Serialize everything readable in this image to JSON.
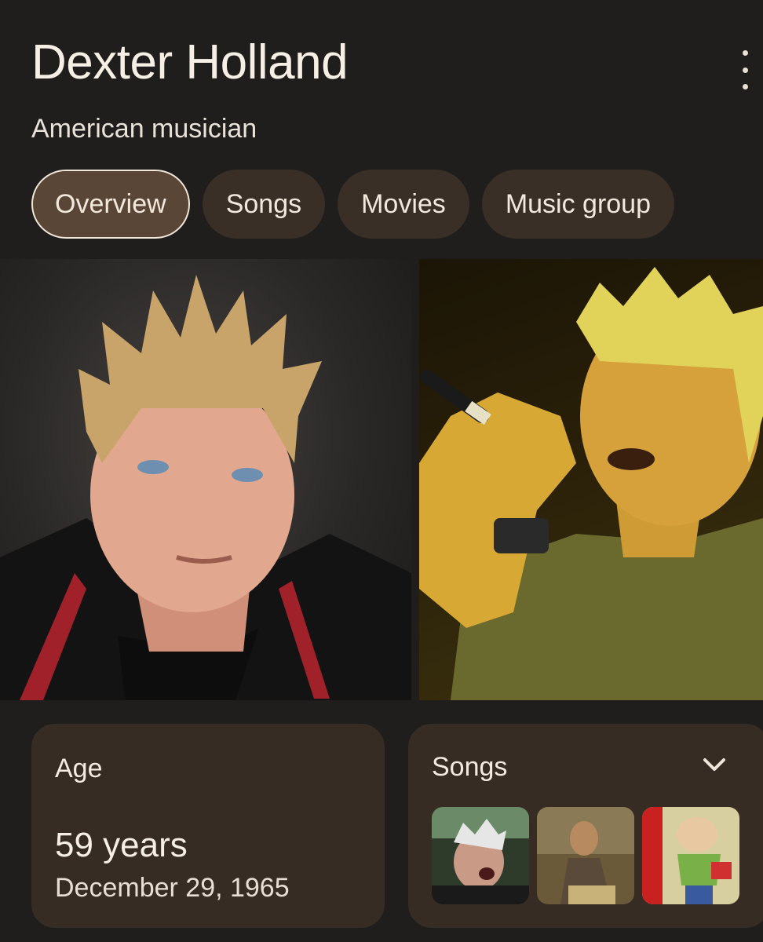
{
  "header": {
    "title": "Dexter Holland",
    "subtitle": "American musician",
    "menu_icon": "more-vert-icon"
  },
  "tabs": [
    {
      "label": "Overview",
      "active": true
    },
    {
      "label": "Songs",
      "active": false
    },
    {
      "label": "Movies",
      "active": false
    },
    {
      "label": "Music group",
      "active": false
    }
  ],
  "age_card": {
    "label": "Age",
    "value": "59 years",
    "birth_date": "December 29, 1965"
  },
  "songs_card": {
    "label": "Songs",
    "expand_icon": "chevron-down-icon"
  },
  "colors": {
    "background": "#1f1e1c",
    "chip": "#3a2f26",
    "chip_active": "#5a4636",
    "card": "#362c24"
  }
}
